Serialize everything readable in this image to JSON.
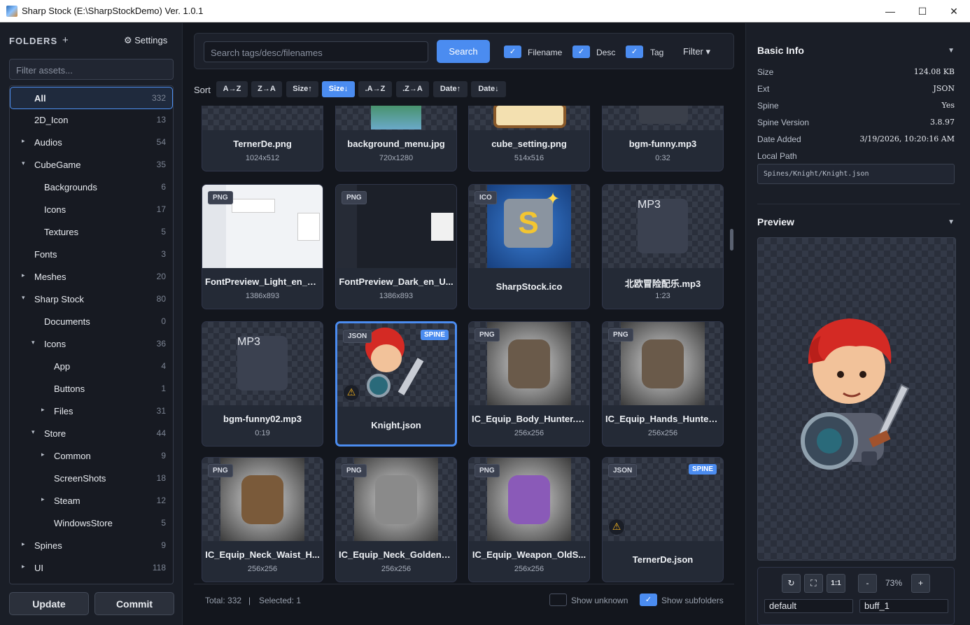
{
  "window": {
    "title": "Sharp Stock (E:\\SharpStockDemo) Ver. 1.0.1",
    "min": "—",
    "max": "☐",
    "close": "✕"
  },
  "sidebar": {
    "header": "FOLDERS",
    "add": "+",
    "settings": "⚙ Settings",
    "filter_placeholder": "Filter assets...",
    "items": [
      {
        "label": "All",
        "count": "332"
      },
      {
        "label": "2D_Icon",
        "count": "13"
      },
      {
        "label": "Audios",
        "count": "54"
      },
      {
        "label": "CubeGame",
        "count": "35"
      },
      {
        "label": "Backgrounds",
        "count": "6"
      },
      {
        "label": "Icons",
        "count": "17"
      },
      {
        "label": "Textures",
        "count": "5"
      },
      {
        "label": "Fonts",
        "count": "3"
      },
      {
        "label": "Meshes",
        "count": "20"
      },
      {
        "label": "Sharp Stock",
        "count": "80"
      },
      {
        "label": "Documents",
        "count": "0"
      },
      {
        "label": "Icons",
        "count": "36"
      },
      {
        "label": "App",
        "count": "4"
      },
      {
        "label": "Buttons",
        "count": "1"
      },
      {
        "label": "Files",
        "count": "31"
      },
      {
        "label": "Store",
        "count": "44"
      },
      {
        "label": "Common",
        "count": "9"
      },
      {
        "label": "ScreenShots",
        "count": "18"
      },
      {
        "label": "Steam",
        "count": "12"
      },
      {
        "label": "WindowsStore",
        "count": "5"
      },
      {
        "label": "Spines",
        "count": "9"
      },
      {
        "label": "UI",
        "count": "118"
      }
    ],
    "update": "Update",
    "commit": "Commit"
  },
  "toolbar": {
    "search_placeholder": "Search tags/desc/filenames",
    "search_btn": "Search",
    "chk_filename": "Filename",
    "chk_desc": "Desc",
    "chk_tag": "Tag",
    "filter": "Filter ▾",
    "check": "✓"
  },
  "sort": {
    "label": "Sort",
    "buttons": [
      "A→Z",
      "Z→A",
      "Size↑",
      "Size↓",
      ".A→Z",
      ".Z→A",
      "Date↑",
      "Date↓"
    ]
  },
  "assets": [
    {
      "name": "TernerDe.png",
      "meta": "1024x512"
    },
    {
      "name": "background_menu.jpg",
      "meta": "720x1280"
    },
    {
      "name": "cube_setting.png",
      "meta": "514x516"
    },
    {
      "name": "bgm-funny.mp3",
      "meta": "0:32"
    },
    {
      "name": "FontPreview_Light_en_U...",
      "meta": "1386x893",
      "badge": "PNG"
    },
    {
      "name": "FontPreview_Dark_en_U...",
      "meta": "1386x893",
      "badge": "PNG"
    },
    {
      "name": "SharpStock.ico",
      "meta": "",
      "badge": "ICO"
    },
    {
      "name": "北欧冒险配乐.mp3",
      "meta": "1:23",
      "audio": "MP3"
    },
    {
      "name": "bgm-funny02.mp3",
      "meta": "0:19",
      "audio": "MP3"
    },
    {
      "name": "Knight.json",
      "meta": "",
      "badge": "JSON",
      "spine": "SPINE"
    },
    {
      "name": "IC_Equip_Body_Hunter.p...",
      "meta": "256x256",
      "badge": "PNG"
    },
    {
      "name": "IC_Equip_Hands_Hunter1...",
      "meta": "256x256",
      "badge": "PNG"
    },
    {
      "name": "IC_Equip_Neck_Waist_H...",
      "meta": "256x256",
      "badge": "PNG"
    },
    {
      "name": "IC_Equip_Neck_GoldenD...",
      "meta": "256x256",
      "badge": "PNG"
    },
    {
      "name": "IC_Equip_Weapon_OldS...",
      "meta": "256x256",
      "badge": "PNG"
    },
    {
      "name": "TernerDe.json",
      "meta": "",
      "badge": "JSON",
      "spine": "SPINE"
    }
  ],
  "footer": {
    "total": "Total: 332",
    "sep": "|",
    "selected": "Selected: 1",
    "show_unknown": "Show unknown",
    "show_subfolders": "Show subfolders"
  },
  "info": {
    "title": "Basic Info",
    "rows": [
      {
        "k": "Size",
        "v": "124.08 KB"
      },
      {
        "k": "Ext",
        "v": "JSON"
      },
      {
        "k": "Spine",
        "v": "Yes"
      },
      {
        "k": "Spine Version",
        "v": "3.8.97"
      },
      {
        "k": "Date Added",
        "v": "3/19/2026, 10:20:16 AM"
      },
      {
        "k": "Local Path",
        "v": ""
      }
    ],
    "path": "Spines/Knight/Knight.json"
  },
  "preview": {
    "title": "Preview",
    "zoom": "73%",
    "reset": "↻",
    "fit": "⛶",
    "one": "1:1",
    "minus": "-",
    "plus": "+",
    "skin": "default",
    "anim": "buff_1"
  }
}
